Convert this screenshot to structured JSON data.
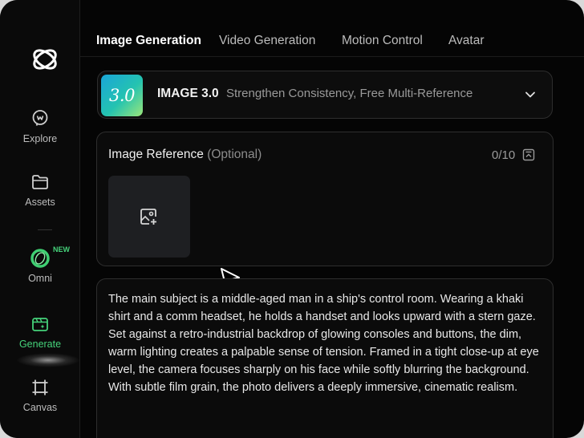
{
  "sidebar": {
    "items": [
      {
        "label": "Explore",
        "icon": "explore-icon"
      },
      {
        "label": "Assets",
        "icon": "folder-icon"
      },
      {
        "label": "Omni",
        "icon": "omni-icon",
        "badge": "NEW"
      },
      {
        "label": "Generate",
        "icon": "generate-icon",
        "active": true
      },
      {
        "label": "Canvas",
        "icon": "canvas-icon"
      }
    ]
  },
  "tabs": [
    {
      "label": "Image Generation",
      "active": true
    },
    {
      "label": "Video Generation"
    },
    {
      "label": "Motion Control"
    },
    {
      "label": "Avatar"
    }
  ],
  "model": {
    "thumb_text": "3.0",
    "name": "IMAGE 3.0",
    "description": "Strengthen Consistency, Free Multi-Reference"
  },
  "reference": {
    "title": "Image Reference",
    "optional": "(Optional)",
    "count": "0/10"
  },
  "prompt": {
    "text": "The main subject is a middle-aged man in a ship's control room. Wearing a khaki shirt and a comm headset, he holds a handset and looks upward with a stern gaze. Set against a retro-industrial backdrop of glowing consoles and buttons, the dim, warm lighting creates a palpable sense of tension. Framed in a tight close-up at eye level, the camera focuses sharply on his face while softly blurring the background. With subtle film grain, the photo delivers a deeply immersive, cinematic realism."
  },
  "colors": {
    "accent": "#45d27a",
    "background": "#050505",
    "border": "#2e2e2e"
  }
}
